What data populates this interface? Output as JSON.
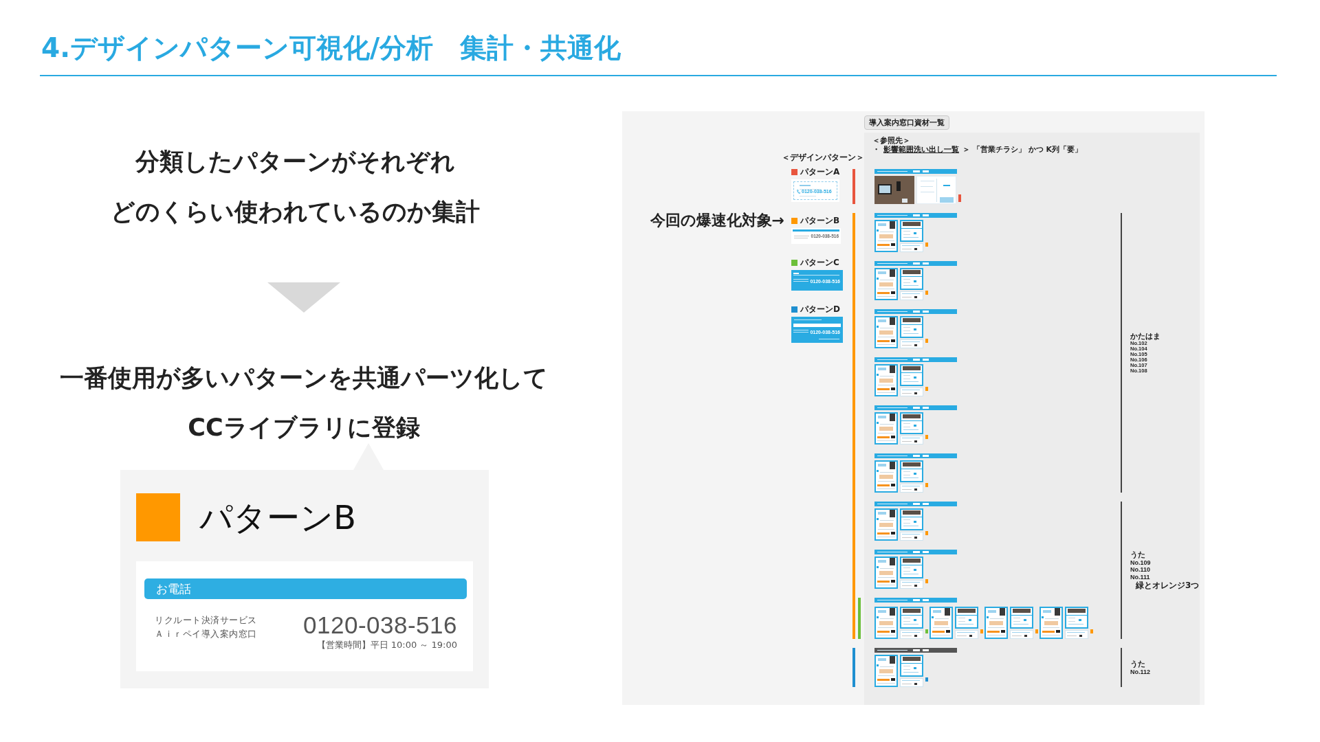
{
  "title": "4.デザインパターン可視化/分析　集計・共通化",
  "summary": [
    "分類したパターンがそれぞれ",
    "どのくらい使われているのか集計"
  ],
  "conclusion": [
    "一番使用が多いパターンを共通パーツ化して",
    "CCライブラリに登録"
  ],
  "pattern_card": {
    "name": "パターンB",
    "heading": "お電話",
    "service_lines": [
      "リクルート決済サービス",
      "Ａｉｒペイ導入案内窓口"
    ],
    "phone": "0120-038-516",
    "hours": "【営業時間】平日 10:00 ～ 19:00"
  },
  "board": {
    "tag": "導入案内窓口資材一覧",
    "reference": {
      "heading": "＜参照先＞",
      "bullet": "・",
      "link": "影響範囲洗い出し一覧",
      "rest": "＞ 「営業チラシ」 かつ K列「要」"
    },
    "legend": {
      "heading": "＜デザインパターン＞",
      "patterns": [
        {
          "label": "パターンA",
          "color": "#e8553e",
          "kind": "outline",
          "phone": "0120-038-516"
        },
        {
          "label": "パターンB",
          "color": "#ff9800",
          "kind": "strip",
          "phone": "0120-038-516",
          "callout": "今回の爆速化対象→"
        },
        {
          "label": "パターンC",
          "color": "#6cbf3a",
          "kind": "filled",
          "phone": "0120-038-516"
        },
        {
          "label": "パターンD",
          "color": "#1f8fd0",
          "kind": "banner",
          "phone": "0120-038-516"
        }
      ]
    },
    "sections": [
      {
        "groups": [
          {
            "kind": "photo",
            "color": "#29abe2",
            "bars": [
              {
                "color": "#e8553e"
              }
            ],
            "markers": [
              {
                "color": "#e8553e"
              }
            ]
          }
        ]
      },
      {
        "note": {
          "author": "かたはま",
          "items": [
            "No.102",
            "No.104",
            "No.105",
            "No.106",
            "No.107",
            "No.108"
          ]
        },
        "groups": [
          {
            "kind": "leaflet",
            "color": "#29abe2",
            "bars": [
              {
                "color": "#ff9800"
              }
            ],
            "markers": [
              {
                "color": "#ff9800"
              }
            ]
          },
          {
            "kind": "leaflet",
            "color": "#29abe2",
            "bars": [
              {
                "color": "#ff9800"
              }
            ],
            "markers": [
              {
                "color": "#ff9800"
              }
            ]
          },
          {
            "kind": "leaflet",
            "color": "#29abe2",
            "bars": [
              {
                "color": "#ff9800"
              }
            ],
            "markers": [
              {
                "color": "#ff9800"
              }
            ]
          },
          {
            "kind": "leaflet",
            "color": "#29abe2",
            "bars": [
              {
                "color": "#ff9800"
              }
            ],
            "markers": [
              {
                "color": "#ff9800"
              }
            ]
          },
          {
            "kind": "leaflet",
            "color": "#29abe2",
            "bars": [
              {
                "color": "#ff9800"
              }
            ],
            "markers": [
              {
                "color": "#ff9800"
              }
            ]
          },
          {
            "kind": "leaflet",
            "color": "#29abe2",
            "bars": [
              {
                "color": "#ff9800"
              }
            ],
            "markers": [
              {
                "color": "#ff9800"
              }
            ]
          }
        ]
      },
      {
        "note": {
          "author": "うた",
          "items": [
            "No.109",
            "No.110",
            "No.111"
          ],
          "comment": "緑とオレンジ3つ"
        },
        "groups": [
          {
            "kind": "leaflet",
            "color": "#29abe2",
            "bars": [
              {
                "color": "#ff9800"
              }
            ],
            "markers": [
              {
                "color": "#ff9800"
              }
            ]
          },
          {
            "kind": "leaflet",
            "color": "#29abe2",
            "bars": [
              {
                "color": "#ff9800"
              }
            ],
            "markers": [
              {
                "color": "#ff9800"
              }
            ]
          },
          {
            "kind": "leaflet",
            "color": "#29abe2",
            "bars": [
              {
                "color": "#ff9800"
              },
              {
                "color": "#6cbf3a"
              }
            ],
            "markers": [
              {
                "color": "#6cbf3a"
              },
              {
                "color": "#ff9800"
              },
              {
                "color": "#ff9800"
              },
              {
                "color": "#ff9800"
              }
            ]
          }
        ]
      },
      {
        "note": {
          "author": "うた",
          "items": [
            "No.112"
          ]
        },
        "groups": [
          {
            "kind": "leaflet",
            "color": "#555555",
            "bars": [
              {
                "color": "#1f8fd0"
              }
            ],
            "markers": [
              {
                "color": "#1f8fd0"
              }
            ]
          }
        ]
      }
    ]
  }
}
